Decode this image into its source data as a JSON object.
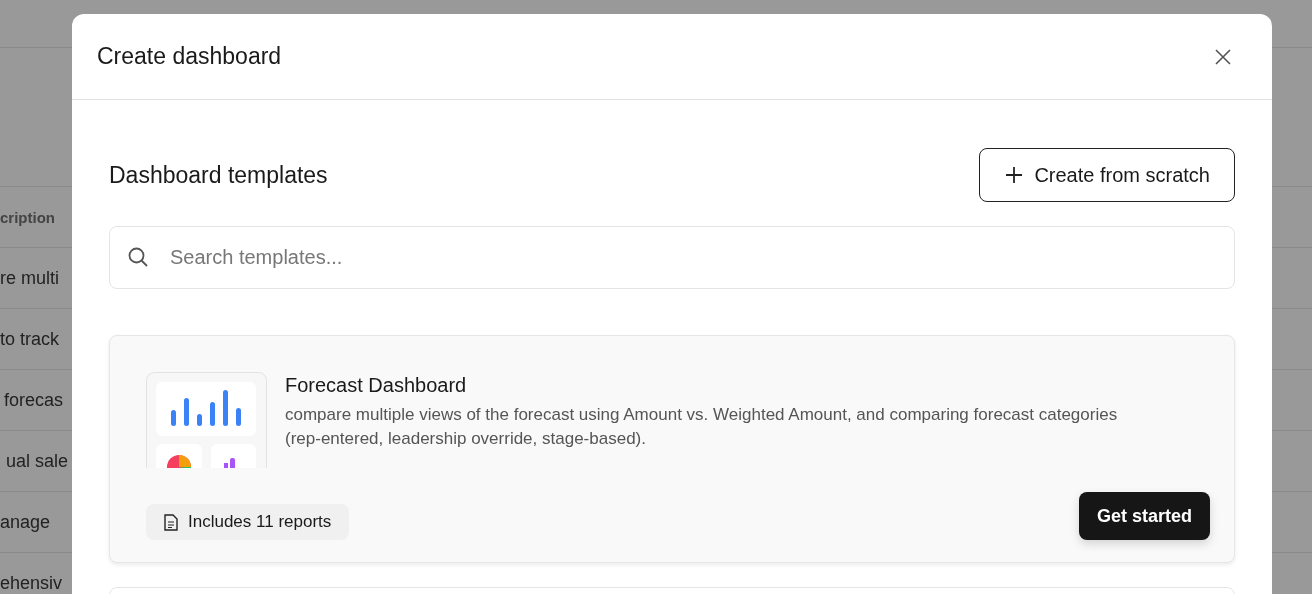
{
  "background_table": {
    "header": "cription",
    "rows": [
      "re multi",
      "to track",
      "forecas",
      "ual sale",
      "anage",
      "ehensiv"
    ]
  },
  "dialog": {
    "title": "Create dashboard",
    "section_title": "Dashboard templates",
    "create_button": "Create from scratch",
    "search": {
      "placeholder": "Search templates..."
    },
    "templates": [
      {
        "title": "Forecast Dashboard",
        "description": "compare multiple views of the forecast using Amount vs. Weighted Amount, and comparing forecast categories (rep-entered, leadership override, stage-based).",
        "reports": "Includes 11 reports",
        "action": "Get started"
      }
    ]
  }
}
